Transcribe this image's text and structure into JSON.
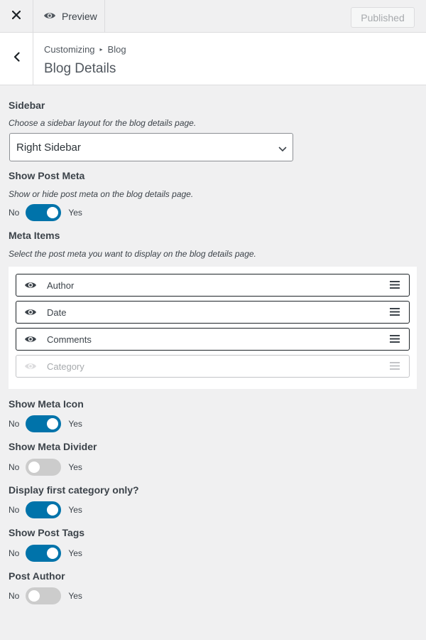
{
  "topbar": {
    "close_icon": "close-icon",
    "preview_label": "Preview",
    "preview_icon": "eye-icon",
    "publish_label": "Published"
  },
  "header": {
    "back_icon": "chevron-left-icon",
    "breadcrumb_root": "Customizing",
    "breadcrumb_current": "Blog",
    "title": "Blog Details"
  },
  "sidebar_field": {
    "title": "Sidebar",
    "description": "Choose a sidebar layout for the blog details page.",
    "selected": "Right Sidebar"
  },
  "post_meta_field": {
    "title": "Show Post Meta",
    "description": "Show or hide post meta on the blog details page.",
    "no": "No",
    "yes": "Yes",
    "state": "on"
  },
  "meta_items_field": {
    "title": "Meta Items",
    "description": "Select the post meta you want to display on the blog details page.",
    "items": [
      {
        "label": "Author",
        "visible": true
      },
      {
        "label": "Date",
        "visible": true
      },
      {
        "label": "Comments",
        "visible": true
      },
      {
        "label": "Category",
        "visible": false
      }
    ]
  },
  "meta_icon_field": {
    "title": "Show Meta Icon",
    "no": "No",
    "yes": "Yes",
    "state": "on"
  },
  "meta_divider_field": {
    "title": "Show Meta Divider",
    "no": "No",
    "yes": "Yes",
    "state": "off"
  },
  "first_category_field": {
    "title": "Display first category only?",
    "no": "No",
    "yes": "Yes",
    "state": "on"
  },
  "post_tags_field": {
    "title": "Show Post Tags",
    "no": "No",
    "yes": "Yes",
    "state": "on"
  },
  "post_author_field": {
    "title": "Post Author",
    "no": "No",
    "yes": "Yes",
    "state": "off"
  },
  "colors": {
    "toggle_on": "#0073aa",
    "toggle_off": "#cccccc"
  }
}
